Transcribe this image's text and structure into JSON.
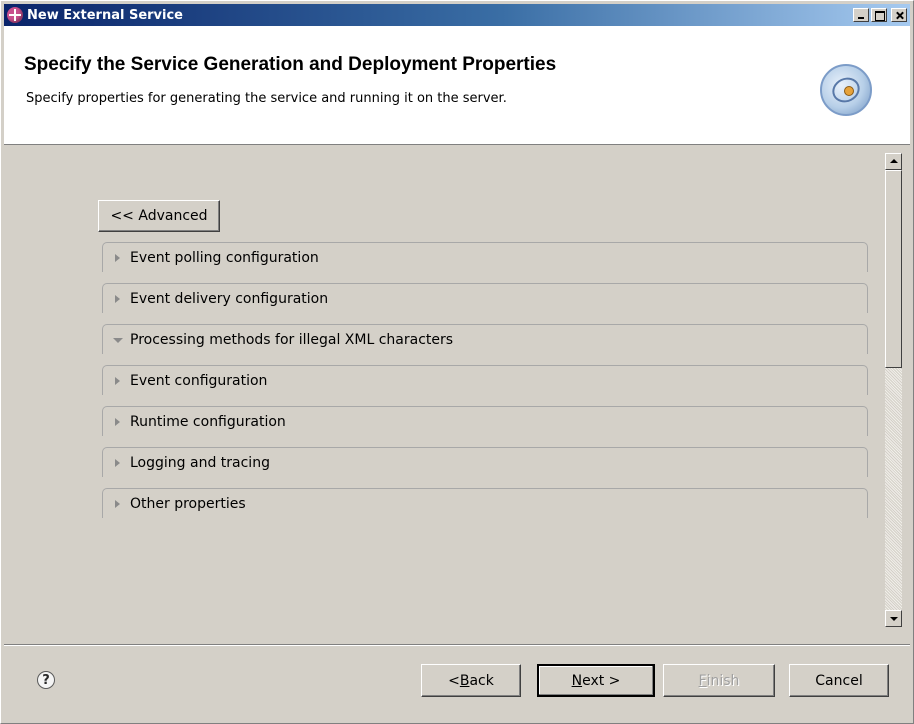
{
  "window": {
    "title": "New External Service"
  },
  "header": {
    "title": "Specify the Service Generation and Deployment Properties",
    "description": "Specify properties for generating the service and running it on the server."
  },
  "advanced_button": {
    "label": "<< Advanced"
  },
  "sections": [
    {
      "label": "Event polling configuration",
      "expanded": false
    },
    {
      "label": "Event delivery configuration",
      "expanded": false
    },
    {
      "label": "Processing methods for illegal XML characters",
      "expanded": true
    },
    {
      "label": "Event configuration",
      "expanded": false
    },
    {
      "label": "Runtime configuration",
      "expanded": false
    },
    {
      "label": "Logging and tracing",
      "expanded": false
    },
    {
      "label": "Other properties",
      "expanded": false
    }
  ],
  "footer": {
    "help_glyph": "?",
    "back": {
      "prefix": "< ",
      "mnemonic": "B",
      "rest": "ack"
    },
    "next": {
      "mnemonic": "N",
      "rest": "ext >"
    },
    "finish": {
      "mnemonic": "F",
      "rest": "inish",
      "enabled": false
    },
    "cancel": "Cancel"
  },
  "icons": {
    "app": "eclipse-plugin-icon",
    "wizard": "wizard-banner-icon",
    "help": "help-icon"
  },
  "colors": {
    "title_bar_start": "#0a246a",
    "title_bar_end": "#a6caf0",
    "dialog_bg": "#d4d0c8"
  }
}
